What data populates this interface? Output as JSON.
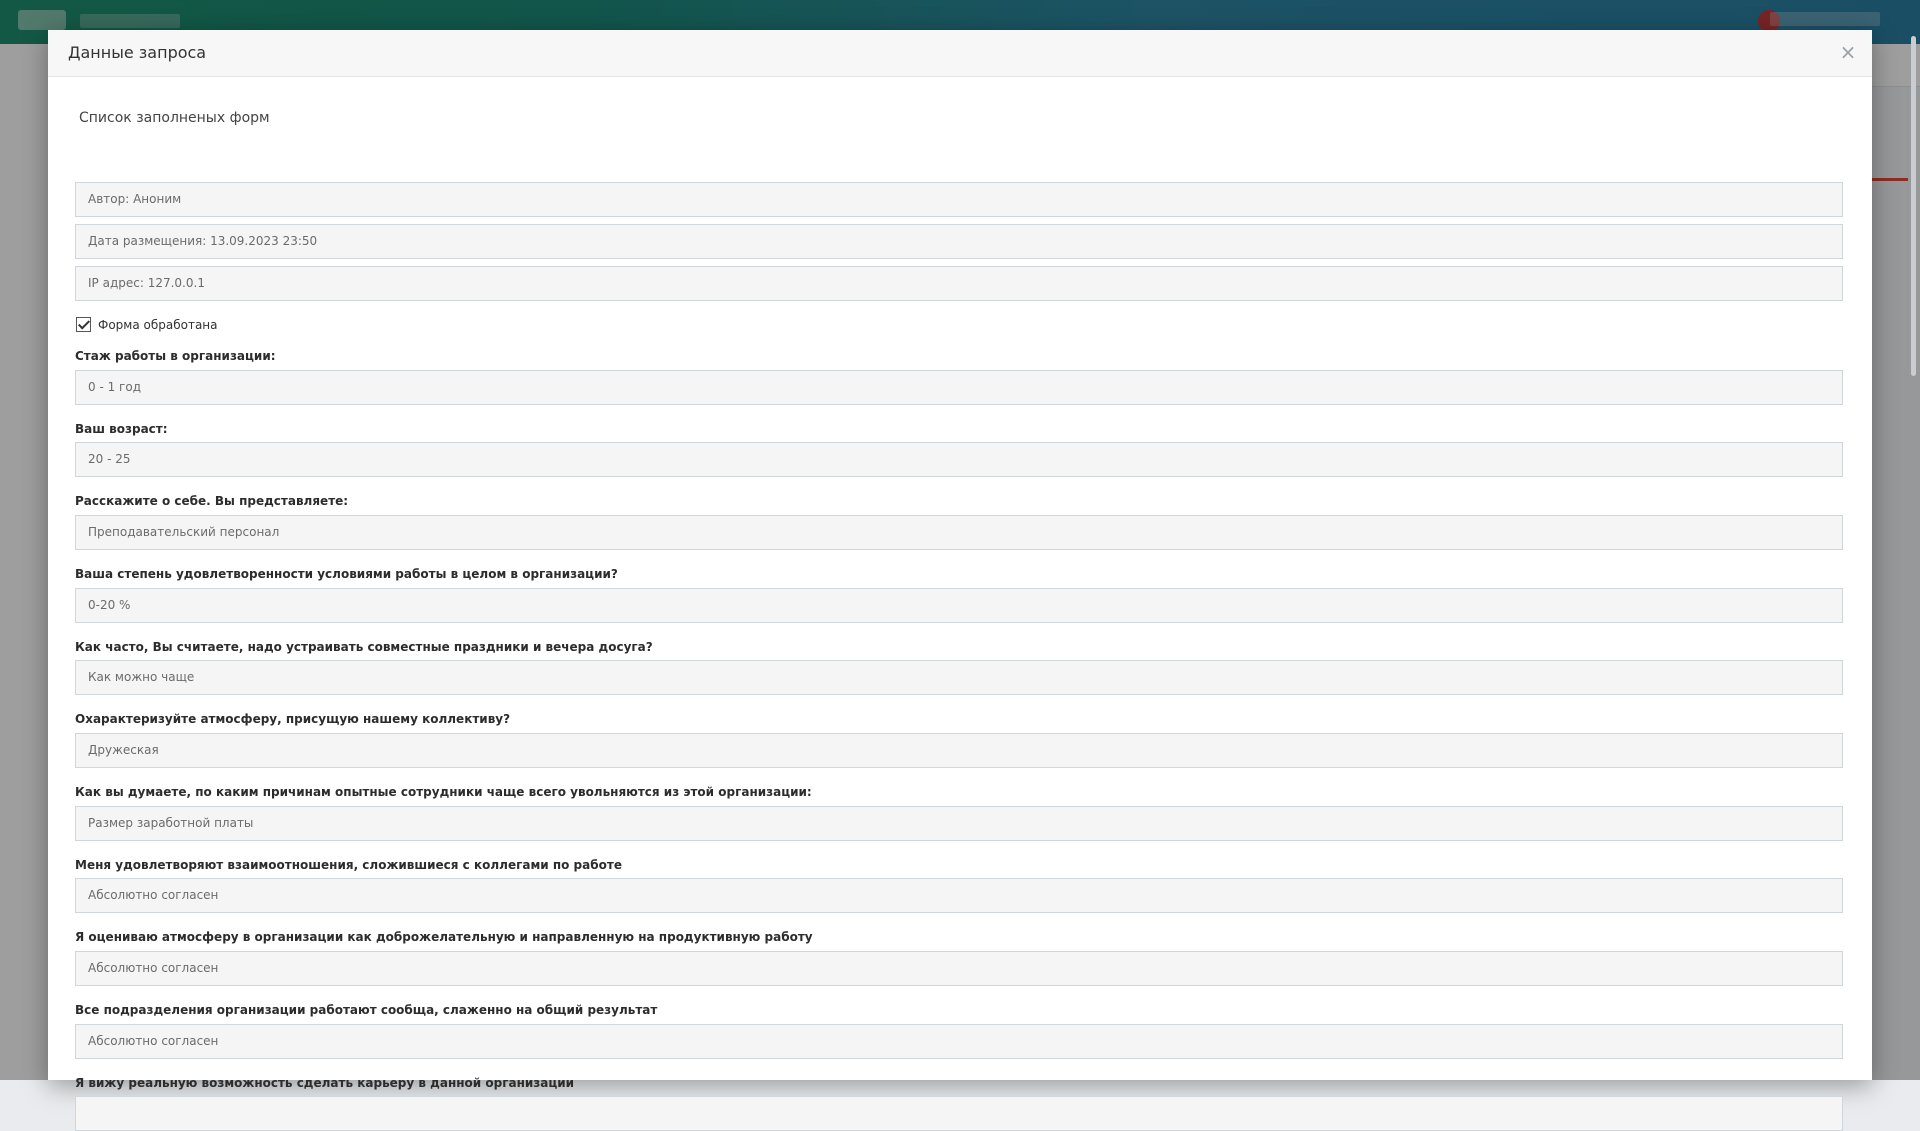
{
  "modal": {
    "title": "Данные запроса",
    "close_symbol": "×",
    "section_title": "Список заполненых форм"
  },
  "meta": {
    "author": "Автор: Аноним",
    "date": "Дата размещения: 13.09.2023 23:50",
    "ip": "IP адрес: 127.0.0.1"
  },
  "processed": {
    "label": "Форма обработана",
    "checked": true
  },
  "questions": [
    {
      "label": "Стаж работы в организации:",
      "answer": "0 - 1 год"
    },
    {
      "label": "Ваш возраст:",
      "answer": "20 - 25"
    },
    {
      "label": "Расскажите о себе. Вы представляете:",
      "answer": "Преподавательский персонал"
    },
    {
      "label": "Ваша степень удовлетворенности условиями работы в целом в организации?",
      "answer": "0-20 %"
    },
    {
      "label": "Как часто, Вы считаете, надо устраивать совместные праздники и вечера досуга?",
      "answer": "Как можно чаще"
    },
    {
      "label": "Охарактеризуйте атмосферу, присущую нашему коллективу?",
      "answer": "Дружеская"
    },
    {
      "label": "Как вы думаете, по каким причинам опытные сотрудники чаще всего увольняются из этой организации:",
      "answer": "Размер заработной платы"
    },
    {
      "label": "Меня удовлетворяют взаимоотношения, сложившиеся с коллегами по работе",
      "answer": "Абсолютно согласен"
    },
    {
      "label": "Я оцениваю атмосферу в организации как доброжелательную и направленную на продуктивную работу",
      "answer": "Абсолютно согласен"
    },
    {
      "label": "Все подразделения организации работают сообща, слаженно на общий результат",
      "answer": "Абсолютно согласен"
    },
    {
      "label": "Я вижу реальную возможность сделать карьеру в данной организации",
      "answer": ""
    }
  ],
  "colors": {
    "topbar_gradient_start": "#1f8f6f",
    "topbar_gradient_end": "#2b7fa3",
    "field_border": "#cfd6dc",
    "field_bg": "#f5f5f5"
  }
}
